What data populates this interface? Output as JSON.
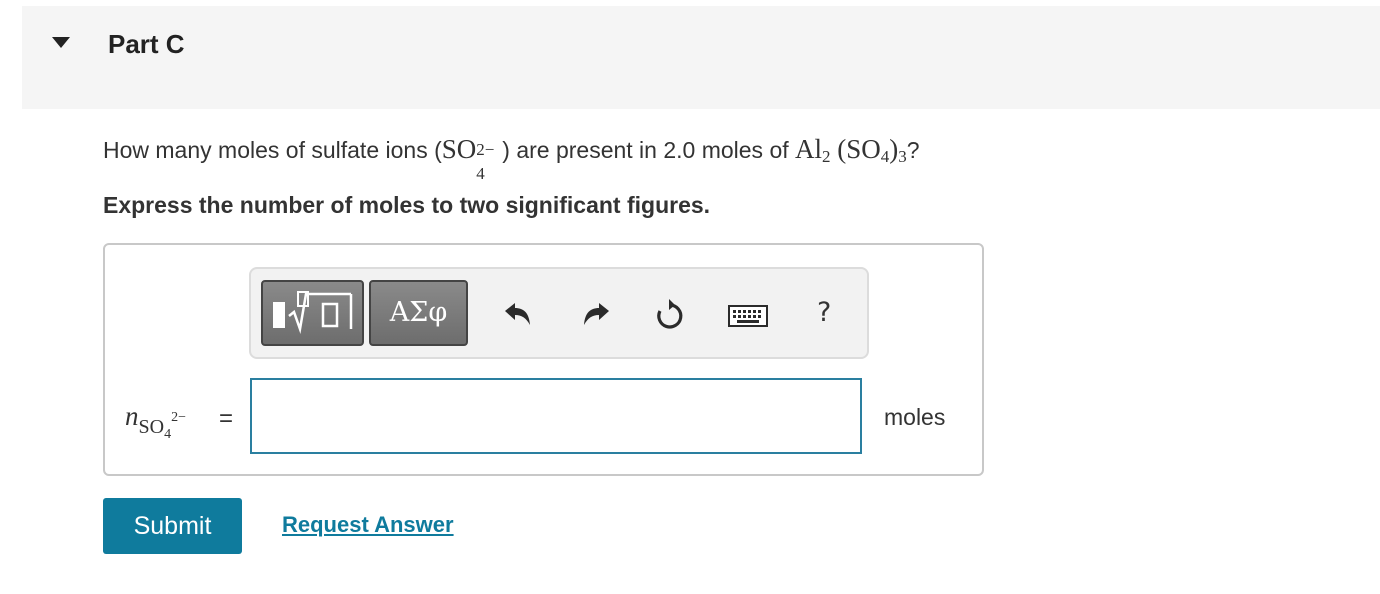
{
  "part": {
    "title": "Part C"
  },
  "question": {
    "prefix": "How many moles of sulfate ions (",
    "ion_base": "SO",
    "ion_sub": "4",
    "ion_sup": "2−",
    "middle": ") are present in 2.0 moles of ",
    "compound_al": "Al",
    "compound_al_sub": "2",
    "compound_paren_open": "(SO",
    "compound_so4_sub": "4",
    "compound_paren_close": ")",
    "compound_outer_sub": "3",
    "suffix": "?"
  },
  "instruction": "Express the number of moles to two significant figures.",
  "toolbar": {
    "templates_icon": "templates-sqrt-icon",
    "greek_label": "ΑΣφ",
    "undo_icon": "undo-icon",
    "redo_icon": "redo-icon",
    "reset_icon": "reset-icon",
    "keyboard_icon": "keyboard-icon",
    "help_label": "?"
  },
  "answer": {
    "var_n": "n",
    "var_sub": "SO",
    "var_sub_4": "4",
    "var_sup": "2−",
    "equals": "=",
    "value": "",
    "units": "moles"
  },
  "actions": {
    "submit_label": "Submit",
    "request_label": "Request Answer"
  },
  "colors": {
    "accent": "#0f7b9d",
    "input_border": "#2a7fa0",
    "header_bg": "#f5f5f5"
  }
}
